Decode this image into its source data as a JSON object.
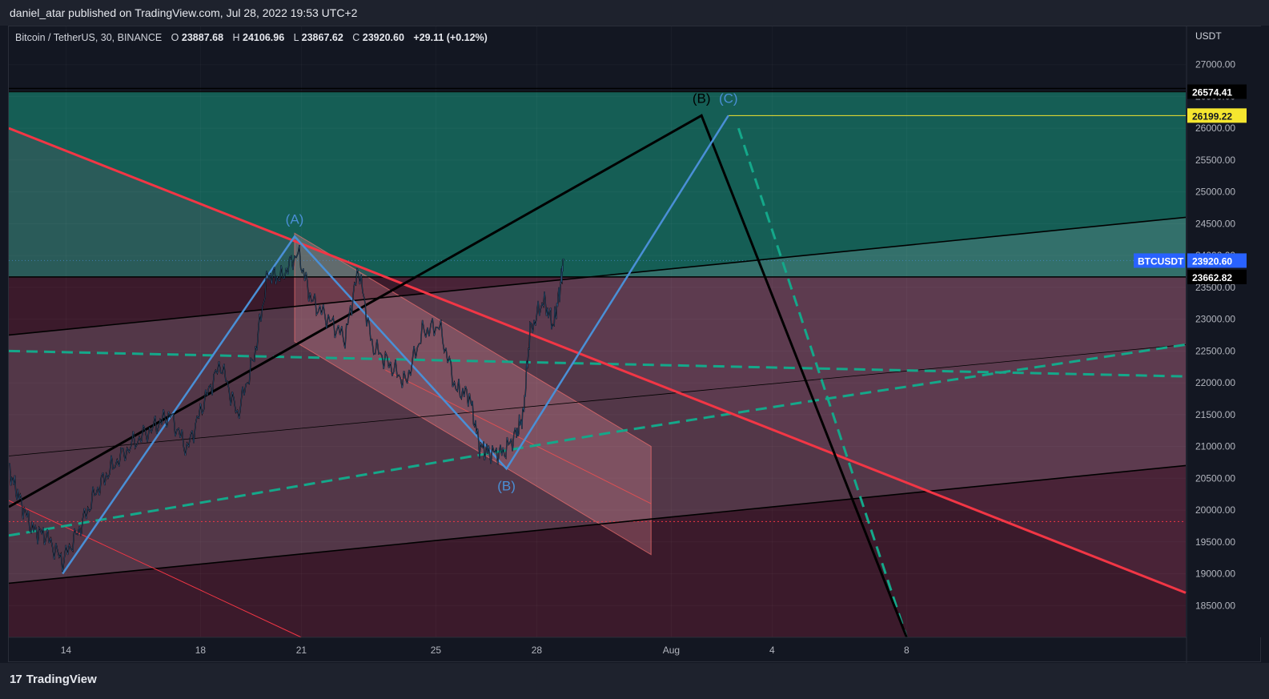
{
  "header": {
    "publisher": "daniel_atar published on TradingView.com, Jul 28, 2022 19:53 UTC+2"
  },
  "legend": {
    "symbol": "Bitcoin / TetherUS, 30, BINANCE",
    "open_label": "O",
    "open": "23887.68",
    "high_label": "H",
    "high": "24106.96",
    "low_label": "L",
    "low": "23867.62",
    "close_label": "C",
    "close": "23920.60",
    "change": "+29.11 (+0.12%)"
  },
  "footer": {
    "brand": "TradingView",
    "brand_icon": "tradingview-logo-icon"
  },
  "colors": {
    "background": "#131722",
    "green_zone": "#155e55",
    "maroon_zone": "#3b1a2b",
    "wave_blue": "#4a8fd6",
    "red_line": "#f23645",
    "teal_dash": "#14a88a",
    "yellow_level": "#f5e62f",
    "price_tag": "#2962ff"
  },
  "chart_data": {
    "type": "line",
    "symbol": "BTCUSDT",
    "interval": "30",
    "exchange": "BINANCE",
    "y_axis_label": "USDT",
    "ylim": [
      18000,
      27600
    ],
    "y_ticks": [
      18500,
      19000,
      19500,
      20000,
      20500,
      21000,
      21500,
      22000,
      22500,
      23000,
      23500,
      24000,
      24500,
      25000,
      25500,
      26000,
      26500,
      27000
    ],
    "y_tick_labels": [
      "18500.00",
      "19000.00",
      "19500.00",
      "20000.00",
      "20500.00",
      "21000.00",
      "21500.00",
      "22000.00",
      "22500.00",
      "23000.00",
      "23500.00",
      "24000.00",
      "24500.00",
      "25000.00",
      "25500.00",
      "26000.00",
      "26500.00",
      "27000.00"
    ],
    "x_ticks": [
      "14",
      "18",
      "21",
      "25",
      "28",
      "Aug",
      "4",
      "8"
    ],
    "x_tick_days": [
      14,
      18,
      21,
      25,
      28,
      32,
      35,
      39
    ],
    "xlim_days": [
      12.3,
      47.3
    ],
    "price_path": {
      "x_days": [
        12.3,
        12.6,
        13.0,
        13.4,
        13.9,
        14.4,
        14.9,
        15.4,
        16.0,
        16.6,
        17.1,
        17.6,
        18.1,
        18.6,
        19.1,
        19.6,
        20.0,
        20.4,
        20.9,
        21.3,
        21.8,
        22.3,
        22.7,
        23.1,
        23.6,
        24.1,
        24.6,
        25.1,
        25.6,
        26.0,
        26.3,
        26.6,
        27.0,
        27.4,
        27.6,
        27.8,
        28.2,
        28.5,
        28.7,
        28.8
      ],
      "y_values": [
        20650,
        20200,
        19700,
        19600,
        19200,
        19700,
        20300,
        20700,
        21050,
        21300,
        21500,
        20950,
        21700,
        22300,
        21500,
        22400,
        23700,
        23650,
        24050,
        23300,
        23000,
        22700,
        23800,
        22600,
        22300,
        22000,
        22800,
        22900,
        21900,
        21800,
        21000,
        20900,
        20900,
        21200,
        21500,
        22800,
        23300,
        22900,
        23500,
        23920
      ]
    },
    "last_price": 23920.6,
    "last_price_label": "BTCUSDT",
    "levels": [
      {
        "name": "green-zone-top",
        "value": 26574.41,
        "label": "26574.41"
      },
      {
        "name": "c-target",
        "value": 26199.22,
        "label": "26199.22"
      },
      {
        "name": "green-zone-bottom",
        "value": 23662.82,
        "label": "23662.82"
      },
      {
        "name": "dotted-support",
        "value": 19820
      }
    ],
    "wave_abc_blue": [
      {
        "day": 13.9,
        "price": 19000
      },
      {
        "day": 20.8,
        "price": 24300,
        "label": "(A)"
      },
      {
        "day": 27.1,
        "price": 20650,
        "label": "(B)"
      },
      {
        "day": 33.7,
        "price": 26200,
        "label": "(C)"
      }
    ],
    "wave_black": [
      {
        "day": 12.3,
        "price": 20050
      },
      {
        "day": 32.9,
        "price": 26200,
        "label": "(B)"
      },
      {
        "day": 39.0,
        "price": 18000
      }
    ],
    "red_trendline": [
      {
        "day": 12.3,
        "price": 26000
      },
      {
        "day": 47.3,
        "price": 18700
      }
    ],
    "red_thin_line": [
      {
        "day": 12.3,
        "price": 20150
      },
      {
        "day": 21.0,
        "price": 18000
      }
    ],
    "channel_upper": [
      {
        "day": 12.3,
        "price": 22750
      },
      {
        "day": 47.3,
        "price": 24600
      }
    ],
    "channel_lower": [
      {
        "day": 12.3,
        "price": 18850
      },
      {
        "day": 47.3,
        "price": 20700
      }
    ],
    "channel_mid": [
      {
        "day": 12.3,
        "price": 20850
      },
      {
        "day": 47.3,
        "price": 22600
      }
    ],
    "parallel_channel": {
      "upper": [
        {
          "day": 20.8,
          "price": 24350
        },
        {
          "day": 31.4,
          "price": 21000
        }
      ],
      "lower": [
        {
          "day": 20.8,
          "price": 22650
        },
        {
          "day": 31.4,
          "price": 19300
        }
      ],
      "mid": [
        {
          "day": 23.5,
          "price": 22200
        },
        {
          "day": 31.4,
          "price": 20100
        }
      ]
    },
    "teal_dashed_lines": [
      [
        {
          "day": 12.3,
          "price": 22500
        },
        {
          "day": 47.3,
          "price": 22100
        }
      ],
      [
        {
          "day": 12.3,
          "price": 19600
        },
        {
          "day": 30.0,
          "price": 21200
        },
        {
          "day": 36.0,
          "price": 21700
        },
        {
          "day": 47.3,
          "price": 22600
        }
      ],
      [
        {
          "day": 34.0,
          "price": 26000
        },
        {
          "day": 39.0,
          "price": 18000
        }
      ]
    ]
  }
}
